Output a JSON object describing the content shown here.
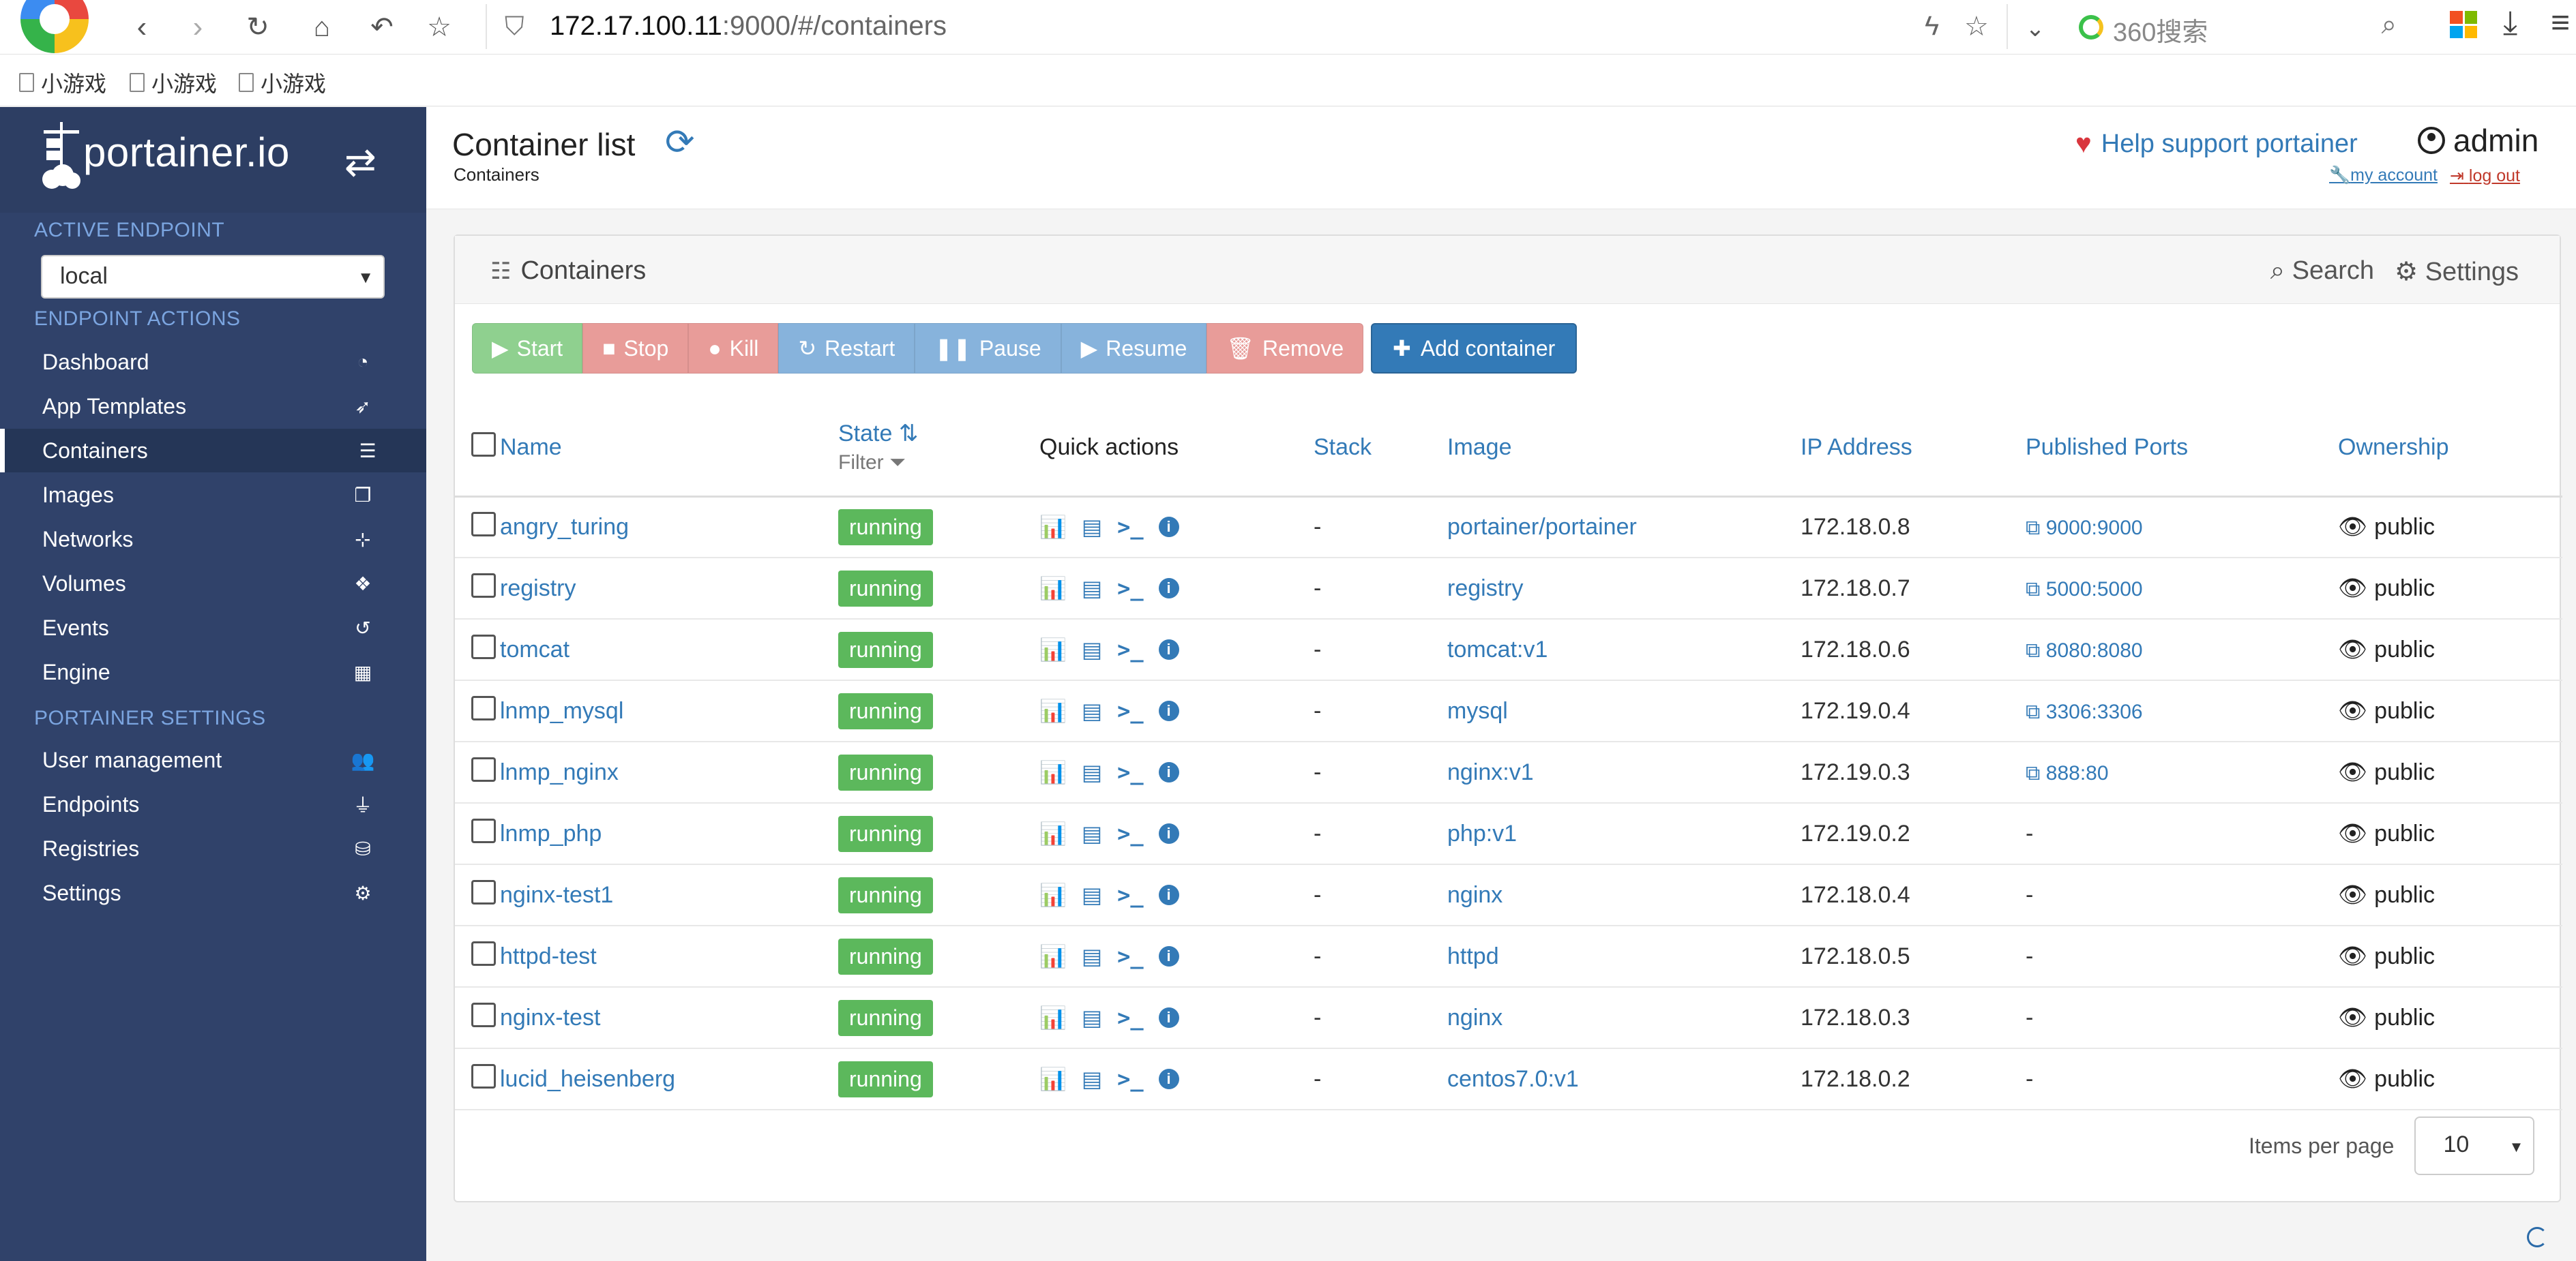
{
  "browser": {
    "url_host": "172.17.100.11",
    "url_rest": ":9000/#/containers",
    "search_engine": "360搜索",
    "bookmarks": [
      "小游戏",
      "小游戏",
      "小游戏"
    ]
  },
  "sidebar": {
    "logo": "portainer.io",
    "active_endpoint_title": "ACTIVE ENDPOINT",
    "endpoint_value": "local",
    "endpoint_actions_title": "ENDPOINT ACTIONS",
    "endpoint_items": [
      {
        "label": "Dashboard",
        "icon": "dashboard-icon"
      },
      {
        "label": "App Templates",
        "icon": "rocket-icon"
      },
      {
        "label": "Containers",
        "icon": "list-icon"
      },
      {
        "label": "Images",
        "icon": "clone-icon"
      },
      {
        "label": "Networks",
        "icon": "sitemap-icon"
      },
      {
        "label": "Volumes",
        "icon": "cubes-icon"
      },
      {
        "label": "Events",
        "icon": "history-icon"
      },
      {
        "label": "Engine",
        "icon": "th-icon"
      }
    ],
    "portainer_settings_title": "PORTAINER SETTINGS",
    "settings_items": [
      {
        "label": "User management",
        "icon": "users-icon"
      },
      {
        "label": "Endpoints",
        "icon": "plug-icon"
      },
      {
        "label": "Registries",
        "icon": "database-icon"
      },
      {
        "label": "Settings",
        "icon": "cogs-icon"
      }
    ]
  },
  "header": {
    "title": "Container list",
    "breadcrumb": "Containers",
    "help": "Help support portainer",
    "username": "admin",
    "my_account": "my account",
    "log_out": "log out"
  },
  "widget": {
    "title": "Containers",
    "search": "Search",
    "settings": "Settings",
    "actions": [
      "Start",
      "Stop",
      "Kill",
      "Restart",
      "Pause",
      "Resume",
      "Remove"
    ],
    "add_container": "Add container"
  },
  "table": {
    "headers": {
      "name": "Name",
      "state": "State",
      "filter": "Filter",
      "quick_actions": "Quick actions",
      "stack": "Stack",
      "image": "Image",
      "ip": "IP Address",
      "ports": "Published Ports",
      "ownership": "Ownership"
    },
    "rows": [
      {
        "name": "angry_turing",
        "state": "running",
        "stack": "-",
        "image": "portainer/portainer",
        "ip": "172.18.0.8",
        "ports": "9000:9000",
        "ownership": "public"
      },
      {
        "name": "registry",
        "state": "running",
        "stack": "-",
        "image": "registry",
        "ip": "172.18.0.7",
        "ports": "5000:5000",
        "ownership": "public"
      },
      {
        "name": "tomcat",
        "state": "running",
        "stack": "-",
        "image": "tomcat:v1",
        "ip": "172.18.0.6",
        "ports": "8080:8080",
        "ownership": "public"
      },
      {
        "name": "lnmp_mysql",
        "state": "running",
        "stack": "-",
        "image": "mysql",
        "ip": "172.19.0.4",
        "ports": "3306:3306",
        "ownership": "public"
      },
      {
        "name": "lnmp_nginx",
        "state": "running",
        "stack": "-",
        "image": "nginx:v1",
        "ip": "172.19.0.3",
        "ports": "888:80",
        "ownership": "public"
      },
      {
        "name": "lnmp_php",
        "state": "running",
        "stack": "-",
        "image": "php:v1",
        "ip": "172.19.0.2",
        "ports": "-",
        "ownership": "public"
      },
      {
        "name": "nginx-test1",
        "state": "running",
        "stack": "-",
        "image": "nginx",
        "ip": "172.18.0.4",
        "ports": "-",
        "ownership": "public"
      },
      {
        "name": "httpd-test",
        "state": "running",
        "stack": "-",
        "image": "httpd",
        "ip": "172.18.0.5",
        "ports": "-",
        "ownership": "public"
      },
      {
        "name": "nginx-test",
        "state": "running",
        "stack": "-",
        "image": "nginx",
        "ip": "172.18.0.3",
        "ports": "-",
        "ownership": "public"
      },
      {
        "name": "lucid_heisenberg",
        "state": "running",
        "stack": "-",
        "image": "centos7.0:v1",
        "ip": "172.18.0.2",
        "ports": "-",
        "ownership": "public"
      }
    ]
  },
  "pager": {
    "label": "Items per page",
    "value": "10"
  },
  "colors": {
    "sidebar": "#30426a",
    "link": "#337ab7",
    "running": "#5cb85c"
  }
}
